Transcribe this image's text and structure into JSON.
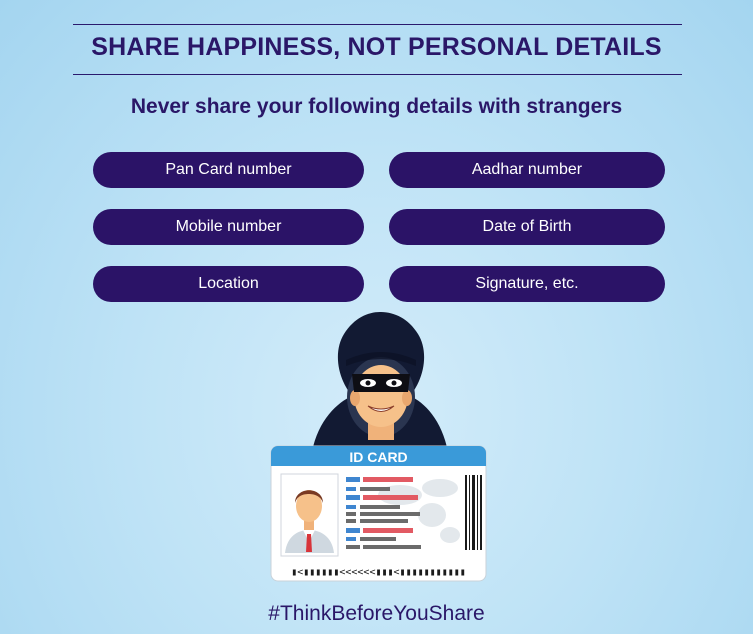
{
  "header": {
    "title": "SHARE HAPPINESS, NOT PERSONAL DETAILS",
    "subtitle": "Never share your following details with strangers"
  },
  "details": [
    "Pan Card number",
    "Aadhar number",
    "Mobile number",
    "Date of Birth",
    "Location",
    "Signature, etc."
  ],
  "illustration": {
    "id_card_label": "ID CARD",
    "mrz_text": "▮<▮▮▮▮▮▮<<<<<<▮▮▮<▮▮▮▮▮▮▮▮▮▮▮",
    "icons": [
      "hooded-thief-icon",
      "id-card-icon",
      "person-photo-icon",
      "barcode-icon"
    ]
  },
  "footer": {
    "hashtag": "#ThinkBeforeYouShare"
  },
  "colors": {
    "primary": "#2b1367",
    "background": "#bfe3f6",
    "card_header": "#3a9ad9",
    "redacted_red": "#e25a63",
    "redacted_blue": "#3f86d0",
    "redacted_gray": "#6b6b6b"
  }
}
